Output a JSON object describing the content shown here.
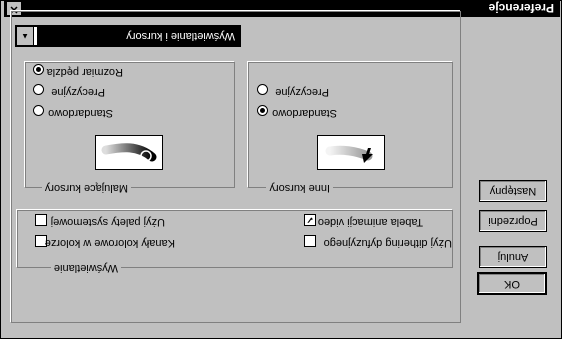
{
  "window": {
    "title": "Preferencje",
    "close_symbol": "✕"
  },
  "mode_select": {
    "value": "Wyświetlanie i kursory",
    "arrow_symbol": "▲"
  },
  "buttons": {
    "ok": "OK",
    "cancel": "Anuluj",
    "prev": "Poprzedni",
    "next": "Następny"
  },
  "display_group": {
    "legend": "Wyświetlanie",
    "options": [
      {
        "label": "Kanały kolorowe w kolorze",
        "checked": false
      },
      {
        "label": "Użyj dithering dyfuzyjnego",
        "checked": false
      },
      {
        "label": "Użyj palety systemowej",
        "checked": false
      },
      {
        "label": "Tabela animacji video",
        "checked": true
      }
    ]
  },
  "painting_cursors": {
    "legend": "Malujące kursory",
    "options": [
      {
        "label": "Standardowo",
        "selected": false
      },
      {
        "label": "Precyzyjne",
        "selected": false
      },
      {
        "label": "Rozmiar pędzla",
        "selected": true
      }
    ]
  },
  "other_cursors": {
    "legend": "Inne kursory",
    "options": [
      {
        "label": "Standardowo",
        "selected": true
      },
      {
        "label": "Precyzyjne",
        "selected": false
      }
    ]
  },
  "icons": {
    "check_mark": "✓"
  }
}
